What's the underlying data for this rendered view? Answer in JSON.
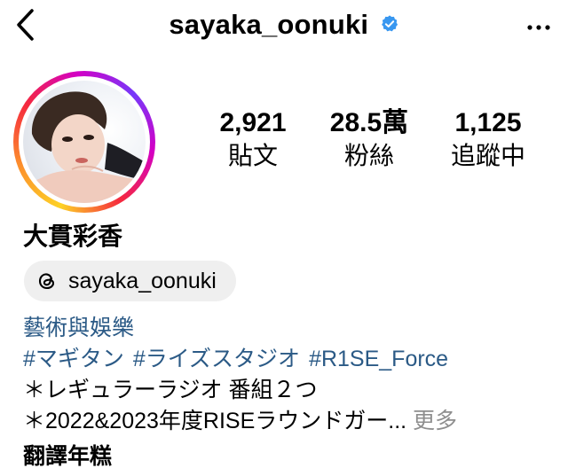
{
  "header": {
    "username": "sayaka_oonuki",
    "verified_color": "#3897f0"
  },
  "profile": {
    "display_name": "大貫彩香",
    "stats": {
      "posts": {
        "value": "2,921",
        "label": "貼文"
      },
      "followers": {
        "value": "28.5萬",
        "label": "粉絲"
      },
      "following": {
        "value": "1,125",
        "label": "追蹤中"
      }
    },
    "threads": {
      "handle": "sayaka_oonuki",
      "icon": "threads-icon"
    },
    "category": "藝術與娛樂",
    "hashtags": [
      "#マギタン",
      "#ライズスタジオ",
      "#R1SE_Force"
    ],
    "bio_lines": [
      "＊レギュラーラジオ 番組２つ",
      "＊2022&2023年度RISEラウンドガー..."
    ],
    "more_label": "更多",
    "translate_label": "翻譯年糕"
  },
  "colors": {
    "link": "#2b5a86",
    "muted": "#8e8e8e",
    "pill_bg": "#efefef"
  }
}
